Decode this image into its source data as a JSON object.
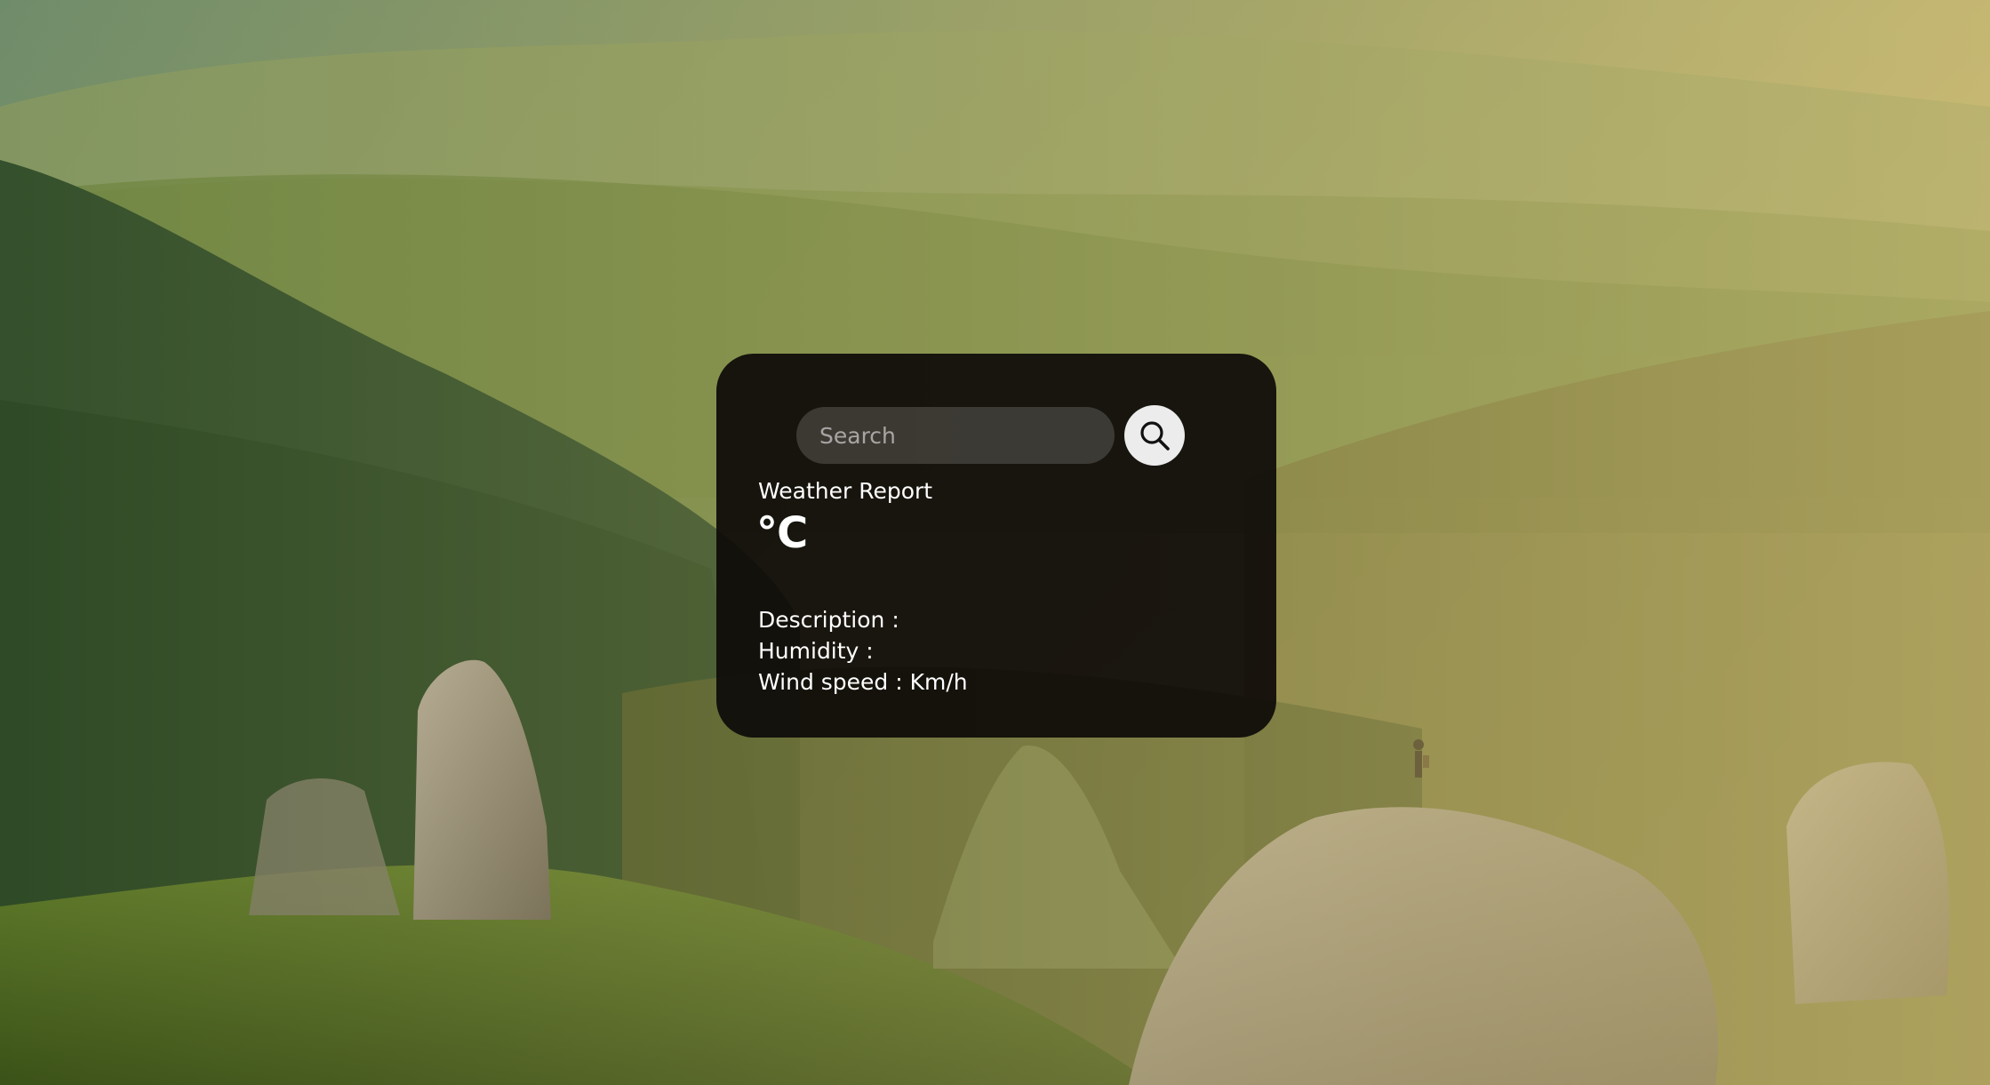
{
  "search": {
    "placeholder": "Search",
    "icon": "search-icon"
  },
  "weather": {
    "title": "Weather Report",
    "temperature_unit": "°C",
    "description_label": "Description :",
    "humidity_label": "Humidity :",
    "wind_label": "Wind speed : Km/h"
  },
  "colors": {
    "card_background": "#0e0b09",
    "search_button": "#ececec",
    "text": "#ffffff"
  }
}
